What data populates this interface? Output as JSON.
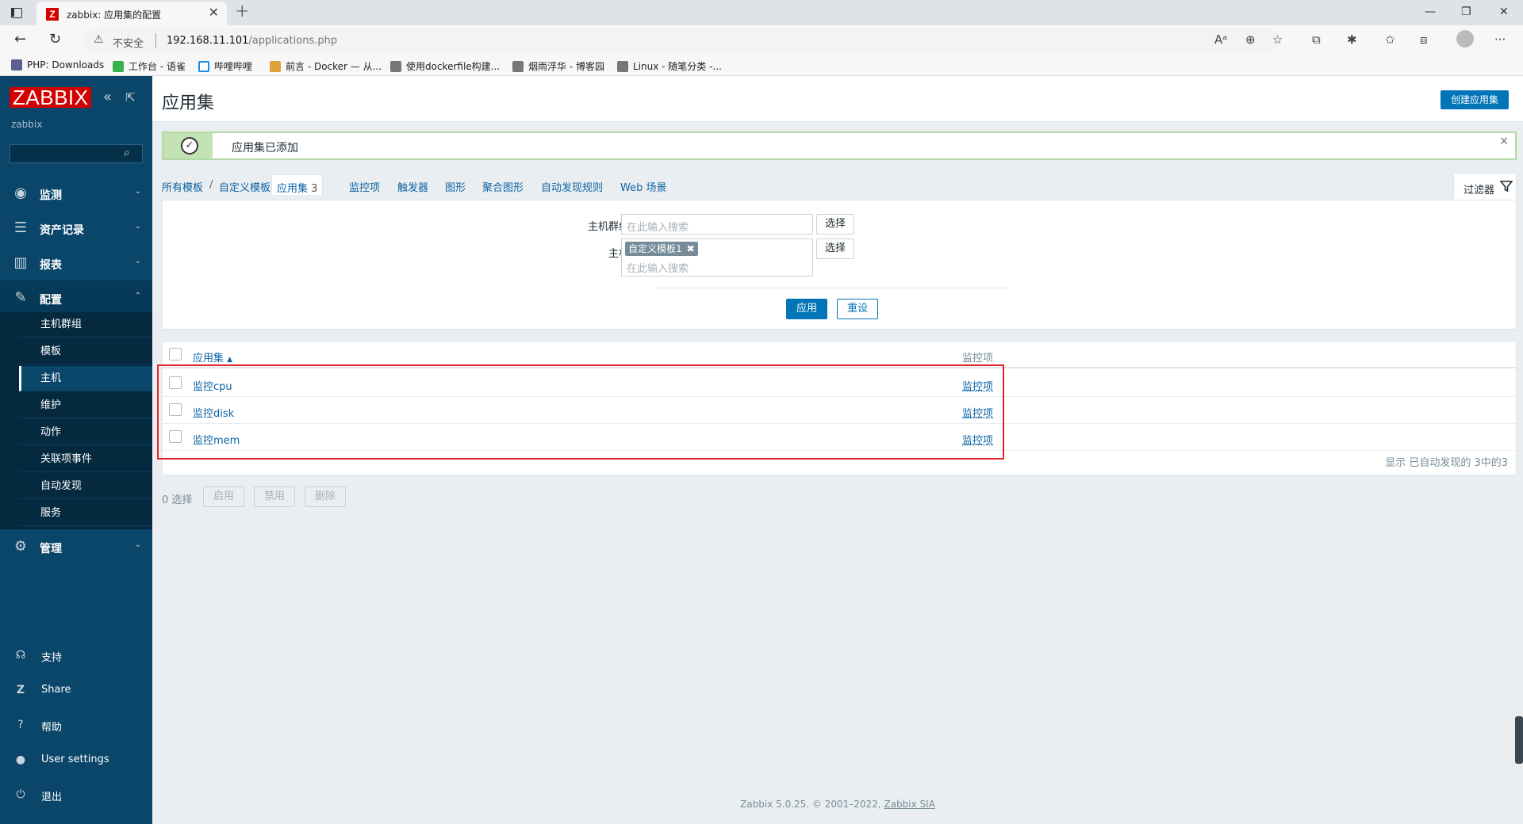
{
  "browser": {
    "tab_title": "zabbix: 应用集的配置",
    "tab_icon_letter": "Z",
    "insecure_label": "不安全",
    "url_host": "192.168.11.101",
    "url_path": "/applications.php",
    "bookmarks": [
      {
        "label": "PHP: Downloads",
        "icon": "php-icon"
      },
      {
        "label": "工作台 - 语雀",
        "icon": "yuque-icon"
      },
      {
        "label": "哔哩哔哩",
        "icon": "bilibili-icon"
      },
      {
        "label": "前言 - Docker — 从...",
        "icon": "rocket-icon"
      },
      {
        "label": "使用dockerfile构建...",
        "icon": "cnblogs-icon"
      },
      {
        "label": "烟雨浮华 - 博客园",
        "icon": "cnblogs-icon"
      },
      {
        "label": "Linux - 随笔分类 -...",
        "icon": "cnblogs-icon"
      }
    ]
  },
  "sidebar": {
    "logo": "ZABBIX",
    "server_name": "zabbix",
    "menu": [
      {
        "label": "监测",
        "icon": "eye-icon"
      },
      {
        "label": "资产记录",
        "icon": "list-icon"
      },
      {
        "label": "报表",
        "icon": "chart-icon"
      },
      {
        "label": "配置",
        "icon": "wrench-icon"
      },
      {
        "label": "管理",
        "icon": "gear-icon"
      }
    ],
    "submenu": [
      "主机群组",
      "模板",
      "主机",
      "维护",
      "动作",
      "关联项事件",
      "自动发现",
      "服务"
    ],
    "active_submenu": "主机",
    "bottom": [
      {
        "label": "支持",
        "icon": "headset-icon"
      },
      {
        "label": "Share",
        "icon": "share-icon"
      },
      {
        "label": "帮助",
        "icon": "help-icon"
      },
      {
        "label": "User settings",
        "icon": "user-icon"
      },
      {
        "label": "退出",
        "icon": "power-icon"
      }
    ]
  },
  "header": {
    "title": "应用集",
    "create_button": "创建应用集"
  },
  "message": {
    "text": "应用集已添加",
    "close": "×"
  },
  "nav": {
    "all_templates": "所有模板",
    "separator": "/",
    "template": "自定义模板1",
    "current": "应用集",
    "current_count": "3",
    "tabs": [
      "监控项",
      "触发器",
      "图形",
      "聚合图形",
      "自动发现规则",
      "Web 场景"
    ],
    "filter_label": "过滤器"
  },
  "filter": {
    "host_group_label": "主机群组",
    "host_group_placeholder": "在此输入搜索",
    "host_label": "主机",
    "host_chip": "自定义模板1",
    "host_placeholder": "在此输入搜索",
    "select_button": "选择",
    "apply_button": "应用",
    "reset_button": "重设"
  },
  "table": {
    "col_name": "应用集",
    "col_items": "监控项",
    "rows": [
      {
        "name": "监控cpu",
        "items": "监控项"
      },
      {
        "name": "监控disk",
        "items": "监控项"
      },
      {
        "name": "监控mem",
        "items": "监控项"
      }
    ],
    "footer": "显示 已自动发现的 3中的3"
  },
  "actions": {
    "selected": "0 选择",
    "enable": "启用",
    "disable": "禁用",
    "delete": "删除"
  },
  "footer": {
    "text": "Zabbix 5.0.25. © 2001–2022, ",
    "link": "Zabbix SIA"
  },
  "colors": {
    "sidebar": "#0a466a",
    "logo_red": "#d40000",
    "primary_blue": "#0275b8",
    "link_blue": "#0a63a5",
    "success_green": "#b2d9a3",
    "highlight_red": "#e0252b"
  }
}
